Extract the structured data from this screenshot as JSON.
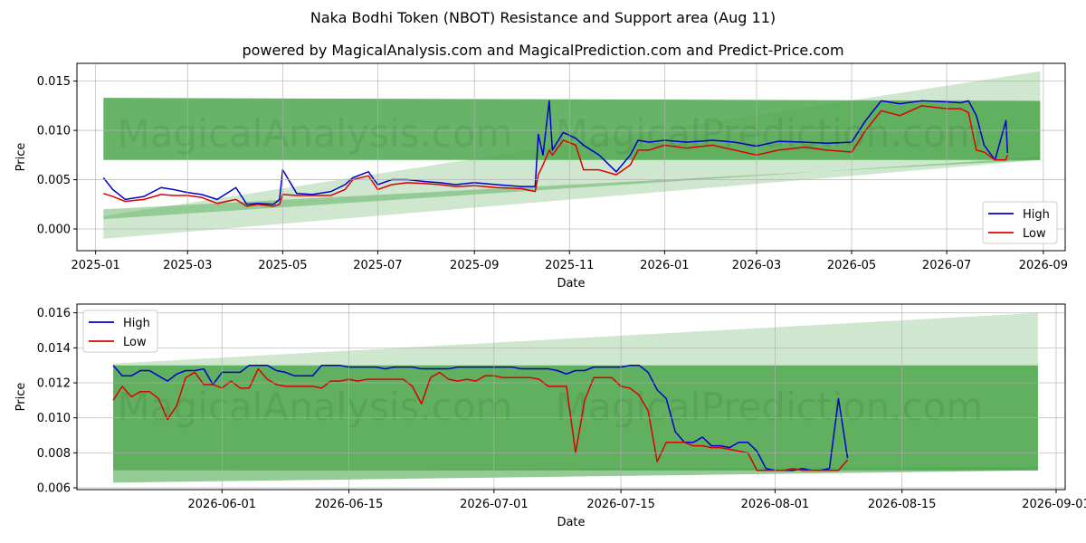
{
  "page": {
    "title": "Naka Bodhi Token (NBOT) Resistance and Support area (Aug 11)",
    "subtitle": "powered by MagicalAnalysis.com and MagicalPrediction.com and Predict-Price.com",
    "watermarks": [
      "MagicalAnalysis.com",
      "MagicalPrediction.com"
    ]
  },
  "colors": {
    "high": "#0000cc",
    "low": "#dd0000",
    "band": "#4ca64c",
    "band_light": "#a8d4a8"
  },
  "chart_data": [
    {
      "type": "line",
      "xlabel": "Date",
      "ylabel": "Price",
      "x_type": "date",
      "xlim": [
        "2024-12-20",
        "2026-09-15"
      ],
      "ylim": [
        -0.0022,
        0.0168
      ],
      "xticks": [
        "2025-01",
        "2025-03",
        "2025-05",
        "2025-07",
        "2025-09",
        "2025-11",
        "2026-01",
        "2026-03",
        "2026-05",
        "2026-07",
        "2026-09"
      ],
      "yticks": [
        "0.000",
        "0.005",
        "0.010",
        "0.015"
      ],
      "grid": true,
      "legend": "lower-right",
      "bands": {
        "resistance": {
          "x": [
            "2025-01-06",
            "2026-08-30"
          ],
          "top": [
            0.0133,
            0.013
          ],
          "bottom": [
            0.007,
            0.007
          ]
        },
        "support_wedge": {
          "x": [
            "2025-01-06",
            "2026-08-30"
          ],
          "top": [
            0.002,
            0.007
          ],
          "bottom": [
            0.001,
            0.0073
          ]
        },
        "projection": {
          "x": [
            "2025-01-06",
            "2026-08-30"
          ],
          "top": [
            0.0013,
            0.016
          ],
          "bottom": [
            -0.001,
            0.007
          ]
        }
      },
      "series": [
        {
          "name": "High",
          "x": [
            "2025-01-06",
            "2025-01-12",
            "2025-01-20",
            "2025-02-01",
            "2025-02-12",
            "2025-02-20",
            "2025-03-01",
            "2025-03-10",
            "2025-03-20",
            "2025-04-01",
            "2025-04-08",
            "2025-04-15",
            "2025-04-25",
            "2025-04-29",
            "2025-05-01",
            "2025-05-10",
            "2025-05-20",
            "2025-06-01",
            "2025-06-10",
            "2025-06-15",
            "2025-06-25",
            "2025-07-01",
            "2025-07-10",
            "2025-07-20",
            "2025-08-01",
            "2025-08-10",
            "2025-08-20",
            "2025-09-01",
            "2025-09-15",
            "2025-10-01",
            "2025-10-10",
            "2025-10-12",
            "2025-10-15",
            "2025-10-19",
            "2025-10-21",
            "2025-10-28",
            "2025-11-05",
            "2025-11-10",
            "2025-11-20",
            "2025-12-01",
            "2025-12-10",
            "2025-12-15",
            "2025-12-22",
            "2026-01-01",
            "2026-01-15",
            "2026-02-01",
            "2026-02-15",
            "2026-03-01",
            "2026-03-15",
            "2026-04-01",
            "2026-04-15",
            "2026-05-01",
            "2026-05-10",
            "2026-05-20",
            "2026-06-01",
            "2026-06-15",
            "2026-07-01",
            "2026-07-10",
            "2026-07-15",
            "2026-07-20",
            "2026-07-25",
            "2026-08-01",
            "2026-08-08",
            "2026-08-09"
          ],
          "values": [
            0.0052,
            0.004,
            0.003,
            0.0033,
            0.0042,
            0.004,
            0.0037,
            0.0035,
            0.003,
            0.0042,
            0.0025,
            0.0026,
            0.0025,
            0.003,
            0.006,
            0.0036,
            0.0035,
            0.0038,
            0.0045,
            0.0052,
            0.0058,
            0.0045,
            0.005,
            0.005,
            0.0048,
            0.0047,
            0.0045,
            0.0047,
            0.0045,
            0.0043,
            0.0043,
            0.0096,
            0.0075,
            0.013,
            0.008,
            0.0098,
            0.0092,
            0.0085,
            0.0075,
            0.0058,
            0.0075,
            0.009,
            0.0088,
            0.009,
            0.0088,
            0.009,
            0.0088,
            0.0084,
            0.0089,
            0.0088,
            0.0087,
            0.0088,
            0.011,
            0.013,
            0.0127,
            0.013,
            0.0129,
            0.0128,
            0.013,
            0.0115,
            0.0085,
            0.007,
            0.011,
            0.0077
          ]
        },
        {
          "name": "Low",
          "x": [
            "2025-01-06",
            "2025-01-12",
            "2025-01-20",
            "2025-02-01",
            "2025-02-12",
            "2025-02-20",
            "2025-03-01",
            "2025-03-10",
            "2025-03-20",
            "2025-04-01",
            "2025-04-08",
            "2025-04-15",
            "2025-04-25",
            "2025-04-29",
            "2025-05-01",
            "2025-05-10",
            "2025-05-20",
            "2025-06-01",
            "2025-06-10",
            "2025-06-15",
            "2025-06-25",
            "2025-07-01",
            "2025-07-10",
            "2025-07-20",
            "2025-08-01",
            "2025-08-10",
            "2025-08-20",
            "2025-09-01",
            "2025-09-15",
            "2025-10-01",
            "2025-10-10",
            "2025-10-12",
            "2025-10-15",
            "2025-10-19",
            "2025-10-21",
            "2025-10-28",
            "2025-11-05",
            "2025-11-10",
            "2025-11-20",
            "2025-12-01",
            "2025-12-10",
            "2025-12-15",
            "2025-12-22",
            "2026-01-01",
            "2026-01-15",
            "2026-02-01",
            "2026-02-15",
            "2026-03-01",
            "2026-03-15",
            "2026-04-01",
            "2026-04-15",
            "2026-05-01",
            "2026-05-10",
            "2026-05-20",
            "2026-06-01",
            "2026-06-15",
            "2026-07-01",
            "2026-07-10",
            "2026-07-15",
            "2026-07-20",
            "2026-07-25",
            "2026-08-01",
            "2026-08-08",
            "2026-08-09"
          ],
          "values": [
            0.0036,
            0.0033,
            0.0028,
            0.003,
            0.0035,
            0.0034,
            0.0034,
            0.0032,
            0.0026,
            0.003,
            0.0023,
            0.0025,
            0.0023,
            0.0025,
            0.0035,
            0.0034,
            0.0034,
            0.0034,
            0.004,
            0.005,
            0.0054,
            0.004,
            0.0045,
            0.0047,
            0.0046,
            0.0045,
            0.0043,
            0.0044,
            0.0042,
            0.0041,
            0.0038,
            0.0055,
            0.0065,
            0.008,
            0.0075,
            0.009,
            0.0085,
            0.006,
            0.006,
            0.0055,
            0.0065,
            0.008,
            0.008,
            0.0085,
            0.0082,
            0.0085,
            0.008,
            0.0075,
            0.008,
            0.0083,
            0.008,
            0.0078,
            0.01,
            0.012,
            0.0115,
            0.0125,
            0.0122,
            0.0122,
            0.0118,
            0.008,
            0.0078,
            0.007,
            0.007,
            0.0075
          ]
        }
      ]
    },
    {
      "type": "line",
      "xlabel": "Date",
      "ylabel": "Price",
      "x_type": "date",
      "xlim": [
        "2026-05-16",
        "2026-09-02"
      ],
      "ylim": [
        0.0059,
        0.0165
      ],
      "xticks": [
        "2026-06-01",
        "2026-06-15",
        "2026-07-01",
        "2026-07-15",
        "2026-08-01",
        "2026-08-15",
        "2026-09-01"
      ],
      "yticks": [
        "0.006",
        "0.008",
        "0.010",
        "0.012",
        "0.014",
        "0.016"
      ],
      "grid": true,
      "legend": "upper-left",
      "bands": {
        "resistance": {
          "x": [
            "2026-05-20",
            "2026-08-30"
          ],
          "top": [
            0.013,
            0.013
          ],
          "bottom": [
            0.007,
            0.007
          ]
        },
        "support_wedge": {
          "x": [
            "2026-05-20",
            "2026-08-30"
          ],
          "top": [
            0.007,
            0.0072
          ],
          "bottom": [
            0.0063,
            0.007
          ]
        },
        "projection": {
          "x": [
            "2026-05-20",
            "2026-08-30"
          ],
          "top": [
            0.0131,
            0.016
          ],
          "bottom": [
            0.0063,
            0.007
          ]
        }
      },
      "series": [
        {
          "name": "High",
          "x": [
            "2026-05-20",
            "2026-05-21",
            "2026-05-22",
            "2026-05-23",
            "2026-05-24",
            "2026-05-25",
            "2026-05-26",
            "2026-05-27",
            "2026-05-28",
            "2026-05-29",
            "2026-05-30",
            "2026-05-31",
            "2026-06-01",
            "2026-06-02",
            "2026-06-03",
            "2026-06-04",
            "2026-06-05",
            "2026-06-06",
            "2026-06-07",
            "2026-06-08",
            "2026-06-09",
            "2026-06-10",
            "2026-06-11",
            "2026-06-12",
            "2026-06-13",
            "2026-06-14",
            "2026-06-15",
            "2026-06-16",
            "2026-06-17",
            "2026-06-18",
            "2026-06-19",
            "2026-06-20",
            "2026-06-21",
            "2026-06-22",
            "2026-06-23",
            "2026-06-24",
            "2026-06-25",
            "2026-06-26",
            "2026-06-27",
            "2026-06-28",
            "2026-06-29",
            "2026-06-30",
            "2026-07-01",
            "2026-07-02",
            "2026-07-03",
            "2026-07-04",
            "2026-07-05",
            "2026-07-06",
            "2026-07-07",
            "2026-07-08",
            "2026-07-09",
            "2026-07-10",
            "2026-07-11",
            "2026-07-12",
            "2026-07-13",
            "2026-07-14",
            "2026-07-15",
            "2026-07-16",
            "2026-07-17",
            "2026-07-18",
            "2026-07-19",
            "2026-07-20",
            "2026-07-21",
            "2026-07-22",
            "2026-07-23",
            "2026-07-24",
            "2026-07-25",
            "2026-07-26",
            "2026-07-27",
            "2026-07-28",
            "2026-07-29",
            "2026-07-30",
            "2026-07-31",
            "2026-08-01",
            "2026-08-02",
            "2026-08-03",
            "2026-08-04",
            "2026-08-05",
            "2026-08-06",
            "2026-08-07",
            "2026-08-08",
            "2026-08-09"
          ],
          "values": [
            0.013,
            0.0124,
            0.0124,
            0.0127,
            0.0127,
            0.0124,
            0.0121,
            0.0125,
            0.0127,
            0.0127,
            0.0128,
            0.0119,
            0.0126,
            0.0126,
            0.0126,
            0.013,
            0.013,
            0.013,
            0.0127,
            0.0126,
            0.0124,
            0.0124,
            0.0124,
            0.013,
            0.013,
            0.013,
            0.0129,
            0.0129,
            0.0129,
            0.0129,
            0.0128,
            0.0129,
            0.0129,
            0.0129,
            0.0128,
            0.0128,
            0.0128,
            0.0128,
            0.0129,
            0.0129,
            0.0129,
            0.0129,
            0.0129,
            0.0129,
            0.0129,
            0.0128,
            0.0128,
            0.0128,
            0.0128,
            0.0127,
            0.0125,
            0.0127,
            0.0127,
            0.0129,
            0.0129,
            0.0129,
            0.0129,
            0.013,
            0.013,
            0.0126,
            0.0116,
            0.0111,
            0.0092,
            0.0086,
            0.0086,
            0.0089,
            0.0084,
            0.0084,
            0.0083,
            0.0086,
            0.0086,
            0.0081,
            0.0071,
            0.007,
            0.007,
            0.007,
            0.0071,
            0.007,
            0.007,
            0.0071,
            0.0111,
            0.0077
          ]
        },
        {
          "name": "Low",
          "x": [
            "2026-05-20",
            "2026-05-21",
            "2026-05-22",
            "2026-05-23",
            "2026-05-24",
            "2026-05-25",
            "2026-05-26",
            "2026-05-27",
            "2026-05-28",
            "2026-05-29",
            "2026-05-30",
            "2026-05-31",
            "2026-06-01",
            "2026-06-02",
            "2026-06-03",
            "2026-06-04",
            "2026-06-05",
            "2026-06-06",
            "2026-06-07",
            "2026-06-08",
            "2026-06-09",
            "2026-06-10",
            "2026-06-11",
            "2026-06-12",
            "2026-06-13",
            "2026-06-14",
            "2026-06-15",
            "2026-06-16",
            "2026-06-17",
            "2026-06-18",
            "2026-06-19",
            "2026-06-20",
            "2026-06-21",
            "2026-06-22",
            "2026-06-23",
            "2026-06-24",
            "2026-06-25",
            "2026-06-26",
            "2026-06-27",
            "2026-06-28",
            "2026-06-29",
            "2026-06-30",
            "2026-07-01",
            "2026-07-02",
            "2026-07-03",
            "2026-07-04",
            "2026-07-05",
            "2026-07-06",
            "2026-07-07",
            "2026-07-08",
            "2026-07-09",
            "2026-07-10",
            "2026-07-11",
            "2026-07-12",
            "2026-07-13",
            "2026-07-14",
            "2026-07-15",
            "2026-07-16",
            "2026-07-17",
            "2026-07-18",
            "2026-07-19",
            "2026-07-20",
            "2026-07-21",
            "2026-07-22",
            "2026-07-23",
            "2026-07-24",
            "2026-07-25",
            "2026-07-26",
            "2026-07-27",
            "2026-07-28",
            "2026-07-29",
            "2026-07-30",
            "2026-07-31",
            "2026-08-01",
            "2026-08-02",
            "2026-08-03",
            "2026-08-04",
            "2026-08-05",
            "2026-08-06",
            "2026-08-07",
            "2026-08-08",
            "2026-08-09"
          ],
          "values": [
            0.011,
            0.0118,
            0.0112,
            0.0115,
            0.0115,
            0.0111,
            0.0099,
            0.0107,
            0.0123,
            0.0126,
            0.0119,
            0.0119,
            0.0117,
            0.0121,
            0.0117,
            0.0117,
            0.0128,
            0.0122,
            0.0119,
            0.0118,
            0.0118,
            0.0118,
            0.0118,
            0.0117,
            0.0121,
            0.0121,
            0.0122,
            0.0121,
            0.0122,
            0.0122,
            0.0122,
            0.0122,
            0.0122,
            0.0118,
            0.0108,
            0.0123,
            0.0126,
            0.0122,
            0.0121,
            0.0122,
            0.0121,
            0.0124,
            0.0124,
            0.0123,
            0.0123,
            0.0123,
            0.0123,
            0.0122,
            0.0118,
            0.0118,
            0.0118,
            0.008,
            0.011,
            0.0123,
            0.0123,
            0.0123,
            0.0118,
            0.0117,
            0.0113,
            0.0104,
            0.0075,
            0.0086,
            0.0086,
            0.0086,
            0.0084,
            0.0084,
            0.0083,
            0.0083,
            0.0082,
            0.0081,
            0.008,
            0.007,
            0.007,
            0.007,
            0.007,
            0.0071,
            0.007,
            0.007,
            0.007,
            0.007,
            0.007,
            0.0076
          ]
        }
      ]
    }
  ]
}
